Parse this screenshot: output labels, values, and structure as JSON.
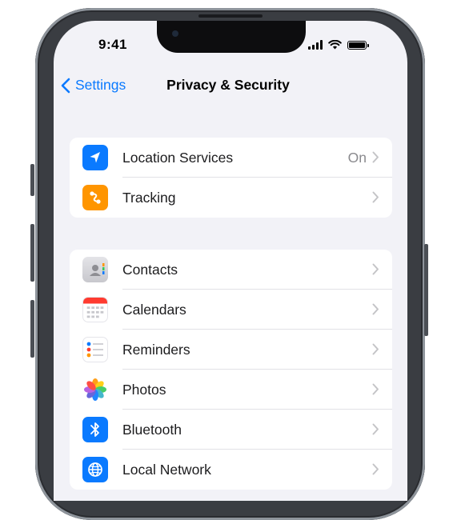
{
  "status_bar": {
    "time": "9:41"
  },
  "nav": {
    "back_label": "Settings",
    "title": "Privacy & Security"
  },
  "groups": [
    {
      "rows": [
        {
          "label": "Location Services",
          "value": "On",
          "icon": "location-arrow-icon",
          "color": "#0a7aff"
        },
        {
          "label": "Tracking",
          "value": "",
          "icon": "tracking-icon",
          "color": "#ff9500"
        }
      ]
    },
    {
      "rows": [
        {
          "label": "Contacts",
          "value": "",
          "icon": "contacts-icon",
          "color": "#d1d1d6"
        },
        {
          "label": "Calendars",
          "value": "",
          "icon": "calendar-icon",
          "color": "#ffffff"
        },
        {
          "label": "Reminders",
          "value": "",
          "icon": "reminders-icon",
          "color": "#ffffff"
        },
        {
          "label": "Photos",
          "value": "",
          "icon": "photos-icon",
          "color": "#ffffff"
        },
        {
          "label": "Bluetooth",
          "value": "",
          "icon": "bluetooth-icon",
          "color": "#0a7aff"
        },
        {
          "label": "Local Network",
          "value": "",
          "icon": "globe-icon",
          "color": "#0a7aff"
        }
      ]
    }
  ]
}
